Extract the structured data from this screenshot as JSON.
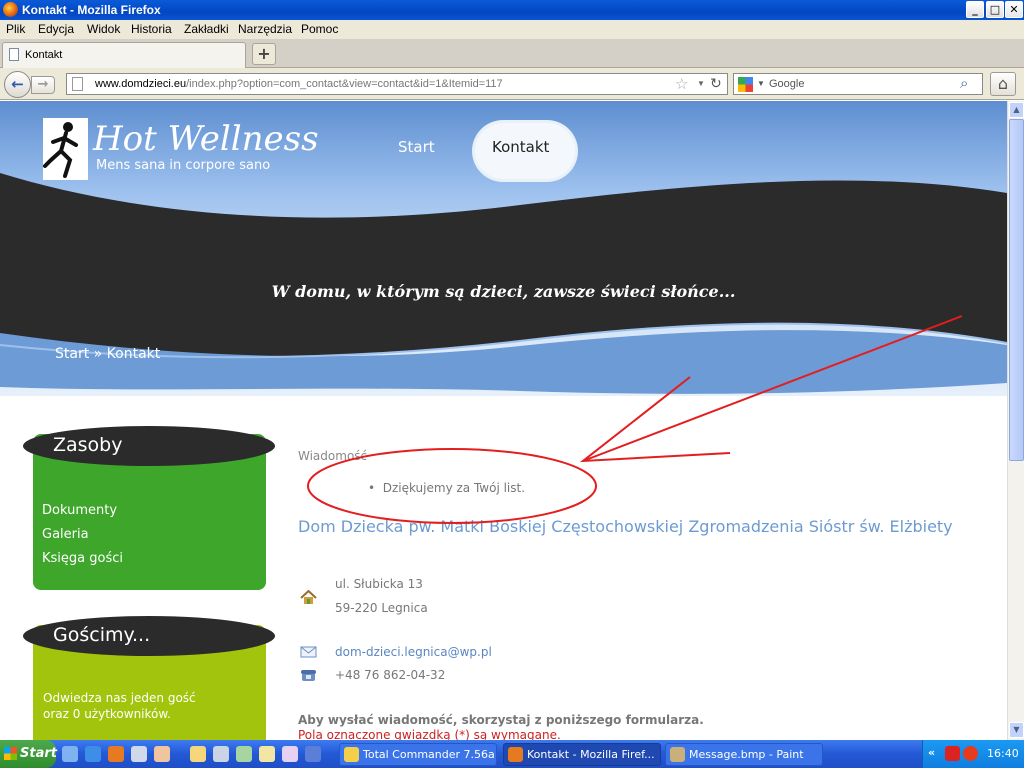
{
  "window": {
    "title": "Kontakt - Mozilla Firefox",
    "controls": {
      "minimize": "_",
      "maximize": "□",
      "close": "✕"
    }
  },
  "menu": [
    "Plik",
    "Edycja",
    "Widok",
    "Historia",
    "Zakładki",
    "Narzędzia",
    "Pomoc"
  ],
  "tab": {
    "label": "Kontakt",
    "new_tab": "+"
  },
  "nav": {
    "url_domain": "www.domdzieci.eu",
    "url_rest": "/index.php?option=com_contact&view=contact&id=1&Itemid=117",
    "search_placeholder": "Google"
  },
  "site": {
    "logo_title": "Hot Wellness",
    "logo_subtitle": "Mens sana in corpore sano",
    "nav_items": [
      "Start",
      "Kontakt"
    ],
    "motto": "W domu, w którym są dzieci, zawsze świeci słońce...",
    "breadcrumb": "Start » Kontakt"
  },
  "sidebar": {
    "resources_title": "Zasoby",
    "resources_links": [
      "Dokumenty",
      "Galeria",
      "Księga gości"
    ],
    "guests_title": "Gościmy...",
    "guests_text": [
      "Odwiedza nas jeden gość",
      "oraz 0 użytkowników."
    ]
  },
  "main": {
    "message_label": "Wiadomość",
    "message_item": "Dziękujemy za Twój list.",
    "org_name": "Dom Dziecka pw. Matki Boskiej Częstochowskiej Zgromadzenia Sióstr św. Elżbiety",
    "address_line1": "ul. Słubicka 13",
    "address_line2": "59-220 Legnica",
    "email": "dom-dzieci.legnica@wp.pl",
    "phone": "+48 76 862-04-32",
    "form_intro": "Aby wysłać wiadomość, skorzystaj z poniższego formularza.",
    "form_required": "Pola oznaczone gwiazdką (*) są wymagane."
  },
  "taskbar": {
    "start": "Start",
    "buttons": [
      "Total Commander 7.56a ...",
      "Kontakt - Mozilla Firef...",
      "Message.bmp - Paint"
    ],
    "tray_chevron": "«",
    "clock": "16:40"
  },
  "colors": {
    "annotation": "#e41e1e",
    "green_box": "#3fa62c",
    "lime_box": "#a3c40c",
    "link_blue": "#6c9bd2"
  }
}
